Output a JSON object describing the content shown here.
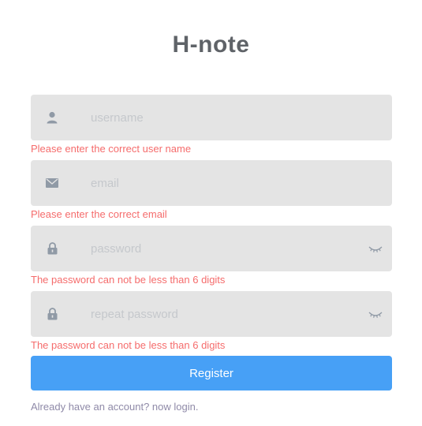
{
  "app": {
    "title": "H-note"
  },
  "form": {
    "username": {
      "placeholder": "username",
      "value": "",
      "error": "Please enter the correct user name",
      "icon": "user-icon"
    },
    "email": {
      "placeholder": "email",
      "value": "",
      "error": "Please enter the correct email",
      "icon": "mail-icon"
    },
    "password": {
      "placeholder": "password",
      "value": "",
      "error": "The password can not be less than 6 digits",
      "icon": "lock-icon",
      "toggle_icon": "eye-closed-icon"
    },
    "repeat_password": {
      "placeholder": "repeat password",
      "value": "",
      "error": "The password can not be less than 6 digits",
      "icon": "lock-icon",
      "toggle_icon": "eye-closed-icon"
    },
    "register_label": "Register",
    "login_link": "Already have an account? now login."
  },
  "colors": {
    "title": "#5f6368",
    "field_background": "#e4e4e4",
    "error": "#f56c6c",
    "primary": "#47a0f6",
    "link": "#8f8aa8"
  }
}
